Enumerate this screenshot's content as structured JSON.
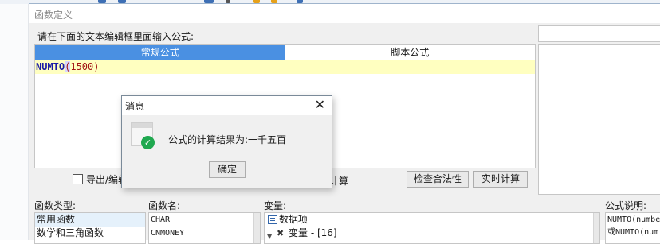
{
  "window": {
    "title": "函数定义"
  },
  "editor": {
    "prompt": "请在下面的文本编辑框里面输入公式:",
    "tabs": [
      "常规公式",
      "脚本公式"
    ],
    "formula": {
      "function": "NUMTO",
      "open_paren": "(",
      "argument": "1500)"
    }
  },
  "options": {
    "export_label": "导出/编辑",
    "calc_hint": "于计算",
    "check_button": "检查合法性",
    "realtime_button": "实时计算"
  },
  "bottom": {
    "fn_type_label": "函数类型:",
    "fn_types": [
      "常用函数",
      "数学和三角函数"
    ],
    "fn_name_label": "函数名:",
    "fn_names": [
      "CHAR",
      "CNMONEY"
    ],
    "var_label": "变量:",
    "var_items": [
      {
        "label": "数据项",
        "icon": "grid-icon"
      },
      {
        "label": "变量 - [16]",
        "icon": "variable-x-icon"
      }
    ],
    "desc_label": "公式说明:",
    "desc_lines": [
      "NUMTO(numbe",
      "或NUMTO(num"
    ]
  },
  "message": {
    "title": "消息",
    "text": "公式的计算结果为:一千五百",
    "ok": "确定",
    "colors": {
      "success": "#1fa84f"
    }
  },
  "colors": {
    "active_tab": "#4a90e2",
    "formula_bg": "#ffffc0"
  }
}
